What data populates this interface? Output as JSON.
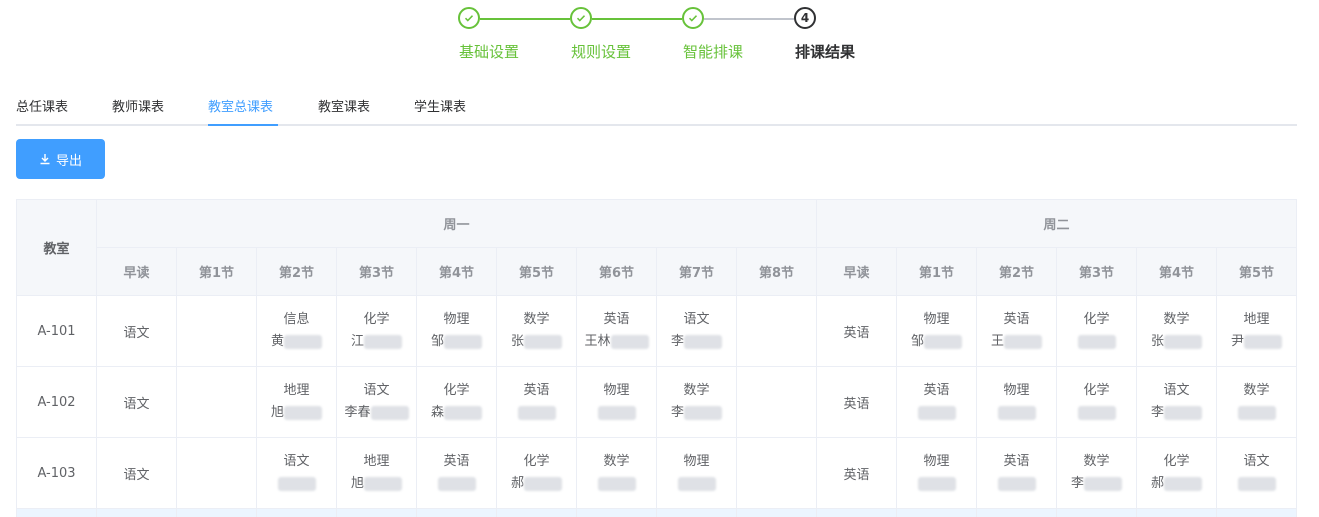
{
  "steps": [
    {
      "label": "基础设置",
      "status": "done"
    },
    {
      "label": "规则设置",
      "status": "done"
    },
    {
      "label": "智能排课",
      "status": "done"
    },
    {
      "label": "排课结果",
      "status": "active",
      "number": "4"
    }
  ],
  "tabs": [
    {
      "label": "总任课表",
      "active": false
    },
    {
      "label": "教师课表",
      "active": false
    },
    {
      "label": "教室总课表",
      "active": true
    },
    {
      "label": "教室课表",
      "active": false
    },
    {
      "label": "学生课表",
      "active": false
    }
  ],
  "export_button": {
    "label": "导出",
    "icon": "download-icon"
  },
  "table": {
    "room_header": "教室",
    "days": [
      {
        "name": "周一",
        "periods": [
          "早读",
          "第1节",
          "第2节",
          "第3节",
          "第4节",
          "第5节",
          "第6节",
          "第7节",
          "第8节"
        ]
      },
      {
        "name": "周二",
        "periods": [
          "早读",
          "第1节",
          "第2节",
          "第3节",
          "第4节",
          "第5节"
        ]
      }
    ],
    "rows": [
      {
        "room": "A-101",
        "cells": [
          [
            "语文"
          ],
          [],
          [
            "信息",
            "黄"
          ],
          [
            "化学",
            "江"
          ],
          [
            "物理",
            "邹"
          ],
          [
            "数学",
            "张"
          ],
          [
            "英语",
            "王林"
          ],
          [
            "语文",
            "李"
          ],
          [],
          [
            "英语"
          ],
          [
            "物理",
            "邹"
          ],
          [
            "英语",
            "王"
          ],
          [
            "化学",
            ""
          ],
          [
            "数学",
            "张"
          ],
          [
            "地理",
            "尹"
          ]
        ]
      },
      {
        "room": "A-102",
        "cells": [
          [
            "语文"
          ],
          [],
          [
            "地理",
            "旭"
          ],
          [
            "语文",
            "李春"
          ],
          [
            "化学",
            "森"
          ],
          [
            "英语",
            ""
          ],
          [
            "物理",
            ""
          ],
          [
            "数学",
            "李"
          ],
          [],
          [
            "英语"
          ],
          [
            "英语",
            ""
          ],
          [
            "物理",
            ""
          ],
          [
            "化学",
            ""
          ],
          [
            "语文",
            "李"
          ],
          [
            "数学",
            ""
          ]
        ]
      },
      {
        "room": "A-103",
        "cells": [
          [
            "语文"
          ],
          [],
          [
            "语文",
            ""
          ],
          [
            "地理",
            "旭"
          ],
          [
            "英语",
            ""
          ],
          [
            "化学",
            "郝"
          ],
          [
            "数学",
            ""
          ],
          [
            "物理",
            ""
          ],
          [],
          [
            "英语"
          ],
          [
            "物理",
            ""
          ],
          [
            "英语",
            ""
          ],
          [
            "数学",
            "李"
          ],
          [
            "化学",
            "郝"
          ],
          [
            "语文",
            ""
          ]
        ]
      }
    ]
  },
  "colors": {
    "success": "#67c23a",
    "primary": "#409eff",
    "active_step": "#303133"
  }
}
